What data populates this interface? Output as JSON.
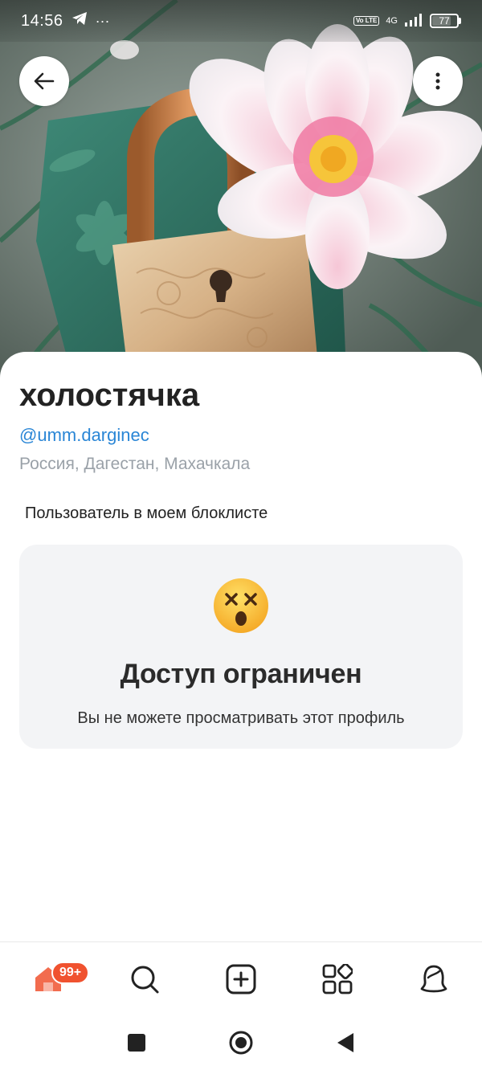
{
  "status_bar": {
    "time": "14:56",
    "overflow": "···",
    "volte": "Vo LTE",
    "network": "4G",
    "battery": "77",
    "battery_level": 0.77
  },
  "profile": {
    "name": "холостячка",
    "handle": "@umm.darginec",
    "location": "Россия, Дагестан, Махачкала",
    "blocklist_note": "Пользователь в моем блоклисте"
  },
  "restricted": {
    "emoji": "😵",
    "title": "Доступ ограничен",
    "message": "Вы не можете просматривать этот профиль"
  },
  "bottom_nav": {
    "items": [
      {
        "name": "home",
        "icon": "home-icon",
        "active": true
      },
      {
        "name": "search",
        "icon": "search-icon"
      },
      {
        "name": "create",
        "icon": "plus-square-icon"
      },
      {
        "name": "services",
        "icon": "apps-grid-icon"
      },
      {
        "name": "profile",
        "icon": "person-icon"
      }
    ],
    "home_badge": "99+"
  },
  "colors": {
    "accent": "#f0522f",
    "link": "#2a86d6",
    "muted": "#9aa1a8",
    "card_bg": "#f3f4f6"
  }
}
